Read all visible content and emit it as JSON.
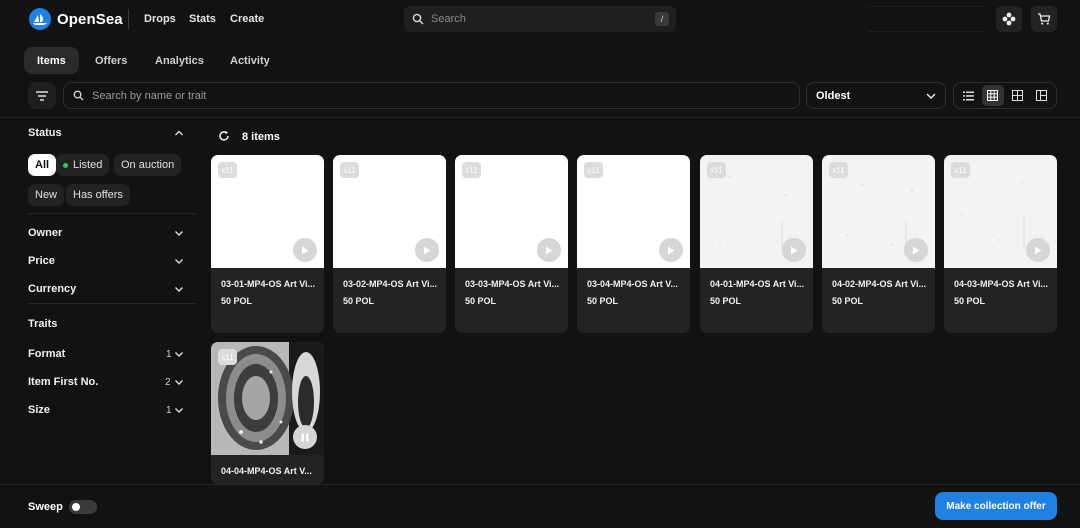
{
  "brand": {
    "name": "OpenSea",
    "accent": "#2081e2"
  },
  "nav": {
    "links": [
      "Drops",
      "Stats",
      "Create"
    ]
  },
  "top_search": {
    "placeholder": "Search",
    "shortcut": "/"
  },
  "top_icons": [
    "settings-flower-icon",
    "cart-icon"
  ],
  "tabs": [
    {
      "label": "Items",
      "active": true
    },
    {
      "label": "Offers",
      "active": false
    },
    {
      "label": "Analytics",
      "active": false
    },
    {
      "label": "Activity",
      "active": false
    }
  ],
  "toolbar": {
    "search_placeholder": "Search by name or trait",
    "sort_value": "Oldest",
    "view_modes": [
      "list-icon",
      "grid-small-icon",
      "grid-large-icon",
      "split-view-icon"
    ],
    "active_view": "grid-small-icon"
  },
  "sidebar": {
    "status": {
      "title": "Status",
      "chips": [
        {
          "label": "All",
          "active": true
        },
        {
          "label": "Listed",
          "active": false,
          "dot_color": "#34c759"
        },
        {
          "label": "On auction",
          "active": false
        },
        {
          "label": "New",
          "active": false
        },
        {
          "label": "Has offers",
          "active": false
        }
      ]
    },
    "filters": [
      "Owner",
      "Price",
      "Currency"
    ],
    "traits_title": "Traits",
    "traits": [
      {
        "label": "Format",
        "count": "1"
      },
      {
        "label": "Item First No.",
        "count": "2"
      },
      {
        "label": "Size",
        "count": "1"
      }
    ]
  },
  "grid": {
    "count_label": "8 items",
    "items": [
      {
        "name": "03-01-MP4-OS Art Vi...",
        "price": "50 POL",
        "badge": "x11",
        "thumb": "white",
        "media_state": "play"
      },
      {
        "name": "03-02-MP4-OS Art Vi...",
        "price": "50 POL",
        "badge": "x11",
        "thumb": "white",
        "media_state": "play"
      },
      {
        "name": "03-03-MP4-OS Art Vi...",
        "price": "50 POL",
        "badge": "x11",
        "thumb": "white",
        "media_state": "play"
      },
      {
        "name": "03-04-MP4-OS Art V...",
        "price": "50 POL",
        "badge": "x11",
        "thumb": "white",
        "media_state": "play"
      },
      {
        "name": "04-01-MP4-OS Art Vi...",
        "price": "50 POL",
        "badge": "x11",
        "thumb": "speckled",
        "media_state": "play"
      },
      {
        "name": "04-02-MP4-OS Art Vi...",
        "price": "50 POL",
        "badge": "x11",
        "thumb": "speckled",
        "media_state": "play"
      },
      {
        "name": "04-03-MP4-OS Art Vi...",
        "price": "50 POL",
        "badge": "x11",
        "thumb": "speckled",
        "media_state": "play"
      },
      {
        "name": "04-04-MP4-OS Art V...",
        "price": "",
        "badge": "x11",
        "thumb": "noise-pattern",
        "media_state": "pause"
      }
    ]
  },
  "bottom": {
    "sweep_label": "Sweep",
    "sweep_on": false,
    "offer_button": "Make collection offer"
  }
}
